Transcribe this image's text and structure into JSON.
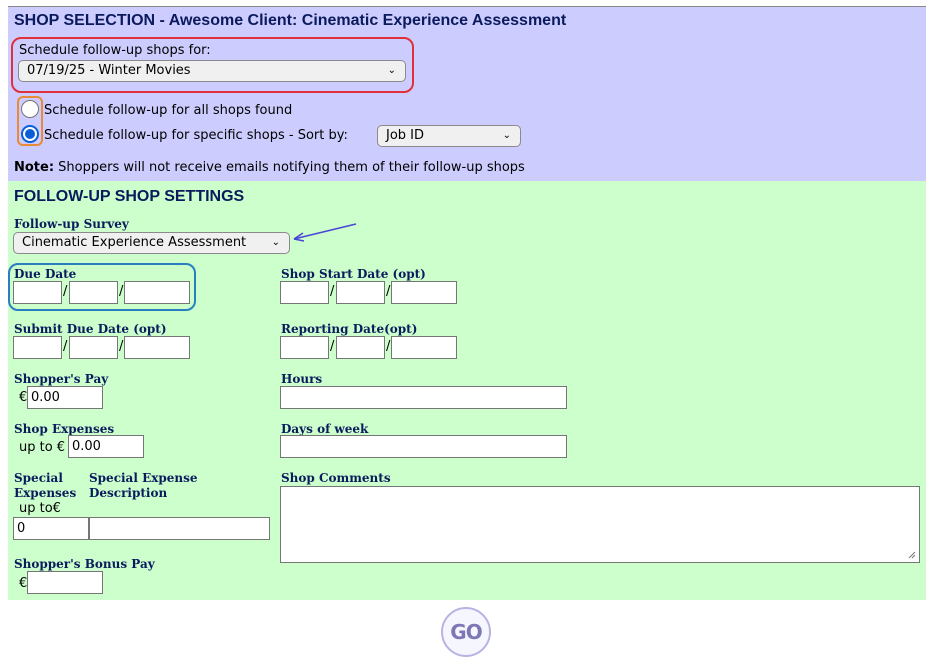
{
  "selection": {
    "title": "SHOP SELECTION - Awesome Client: Cinematic Experience Assessment",
    "schedule_label": "Schedule follow-up shops for:",
    "schedule_value": "07/19/25 - Winter Movies",
    "radio_all_label": "Schedule follow-up for all shops found",
    "radio_specific_label": "Schedule follow-up for specific shops - Sort by:",
    "sort_value": "Job ID",
    "note_bold": "Note:",
    "note_text": " Shoppers will not receive emails notifying them of their follow-up shops"
  },
  "settings": {
    "title": "FOLLOW-UP SHOP SETTINGS",
    "survey_label": "Follow-up Survey",
    "survey_value": "Cinematic Experience Assessment",
    "due_date_label": "Due Date",
    "shop_start_label": "Shop Start Date (opt)",
    "submit_due_label": "Submit Due Date (opt)",
    "reporting_label": "Reporting Date(opt)",
    "pay_label": "Shopper's Pay",
    "pay_currency": "€",
    "pay_value": "0.00",
    "hours_label": "Hours",
    "expenses_label": "Shop Expenses",
    "expenses_prefix": "up to €",
    "expenses_value": "0.00",
    "days_label": "Days of week",
    "special_label_1": "Special",
    "special_label_2": "Expenses",
    "special_label_3": "up to€",
    "special_desc_label_1": "Special Expense",
    "special_desc_label_2": "Description",
    "special_value": "0",
    "comments_label": "Shop Comments",
    "bonus_label": "Shopper's Bonus Pay",
    "bonus_currency": "€"
  },
  "go_label": "GO",
  "colors": {
    "selection_bg": "#ccccff",
    "settings_bg": "#ccffcc",
    "highlight_red": "#e0303a",
    "highlight_orange": "#e98a3a",
    "highlight_blue": "#2a7fc0",
    "arrow": "#4a44d8"
  },
  "icons": [
    "chevron-down-icon",
    "radio-button-icon",
    "annotation-arrow-icon",
    "resize-grip-icon",
    "go-button-icon"
  ]
}
